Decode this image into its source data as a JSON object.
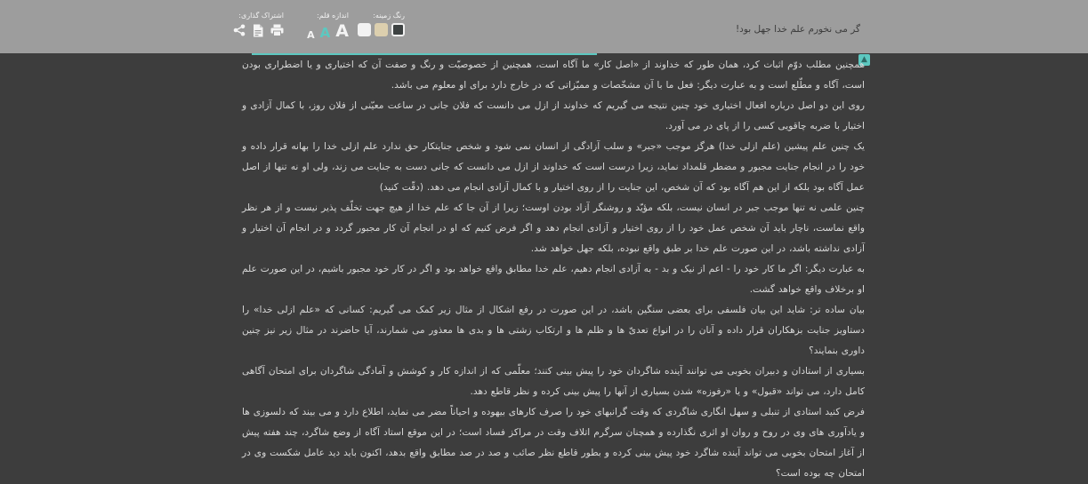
{
  "header": {
    "title": "گر می نخورم علم خدا جهل بود!",
    "background_color_label": "رنگ زمینه:",
    "font_size_label": "اندازه قلم:",
    "share_label": "اشتراک گذاری:",
    "font_size_small": "A",
    "font_size_medium": "A",
    "font_size_large": "A",
    "background_swatches": [
      {
        "name": "light",
        "color": "#f2f2f2"
      },
      {
        "name": "sepia",
        "color": "#dccfae"
      },
      {
        "name": "dark",
        "color": "#3d4242"
      }
    ],
    "accent_color": "#5cc8c0"
  },
  "paragraphs": [
    "همچنین مطلب دوّم اثبات کرد، همان طور که خداوند از «اصل کار» ما آگاه است، همچنین از خصوصیّت و رنگ و صفت آن که اختیاری و یا اضطراری بودن است، آگاه و مطّلع است و به عبارت دیگر: فعل ما با آن مشخّصات و ممیّزاتی که در خارج دارد برای او معلوم می باشد.",
    "روی این دو اصل درباره افعال اختیاری خود چنین نتیجه می گیریم که خداوند از ازل می دانست که فلان جانی در ساعت معیّنی از فلان روز، با کمال آزادی و اختیار با ضربه چاقویی کسی را از پای در می آورد.",
    "یک چنین علم پیشین (علم ازلی خدا) هرگز موجب «جبر» و سلب آزادگی از انسان نمی شود و شخص جنایتکار حق ندارد علم ازلی خدا را بهانه قرار داده و خود را در انجام جنایت مجبور و مضطر قلمداد نماید، زیرا درست است که خداوند از ازل می دانست که جانی دست به جنایت می زند، ولی او نه تنها از اصل عمل آگاه بود بلکه از این هم آگاه بود که آن شخص، این جنایت را از روی اختیار و با کمال آزادی انجام می دهد. (دقّت کنید)",
    "چنین علمی نه تنها موجب جبر در انسان نیست، بلکه مؤیّد و روشنگر آزاد بودن اوست؛ زیرا از آن جا که علم خدا از هیچ جهت تخلّف پذیر نیست و از هر نظر واقع نماست، ناچار باید آن شخص عمل خود را از روی اختیار و آزادی انجام دهد و اگر فرض کنیم که او در انجام آن کار مجبور گردد و در انجام آن اختیار و آزادی نداشته باشد، در این صورت علم خدا بر طبق واقع نبوده، بلکه جهل خواهد شد.",
    "به عبارت دیگر: اگر ما کار خود را - اعم از نیک و بد - به آزادی انجام دهیم، علم خدا مطابق واقع خواهد بود و اگر در کار خود مجبور باشیم، در این صورت علم او برخلاف واقع خواهد گشت.",
    "بیان ساده تر: شاید این بیان فلسفی برای بعضی سنگین باشد، در این صورت در رفع اشکال از مثال زیر کمک می گیریم: کسانی که «علم ازلی خدا» را دستاویز جنایت بزهکاران قرار داده و آنان را در انواع تعدیّ ها و ظلم ها و ارتکاب زشتی ها و بدی ها معذور می شمارند، آیا حاضرند در مثال زیر نیز چنین داوری بنمایند؟",
    "بسیاری از استادان و دبیران بخوبی می توانند آینده شاگردان خود را پیش بینی کنند؛ معلّمی که از اندازه کار و کوشش و آمادگی شاگردان برای امتحان آگاهی کامل دارد، می تواند «قبول» و یا «رفوزه» شدن بسیاری از آنها را پیش بینی کرده و نظر قاطع دهد.",
    "فرض کنید استادی از تنبلی و سهل انگاری شاگردی که وقت گرانبهای خود را صرف کارهای بیهوده و احیاناً مضر می نماید، اطلاع دارد و می بیند که دلسوزی ها و یادآوری های وی در روح و روان او اثری نگذارده و همچنان سرگرم اتلاف وقت در مراکز فساد است؛ در این موقع استاد آگاه از وضع شاگرد، چند هفته پیش از آغاز امتحان بخوبی می تواند آینده شاگرد خود پیش بینی کرده و بطور قاطع نظر صائب و صد در صد مطابق واقع بدهد، اکنون باید دید عامل شکست وی در امتحان چه بوده است؟"
  ]
}
